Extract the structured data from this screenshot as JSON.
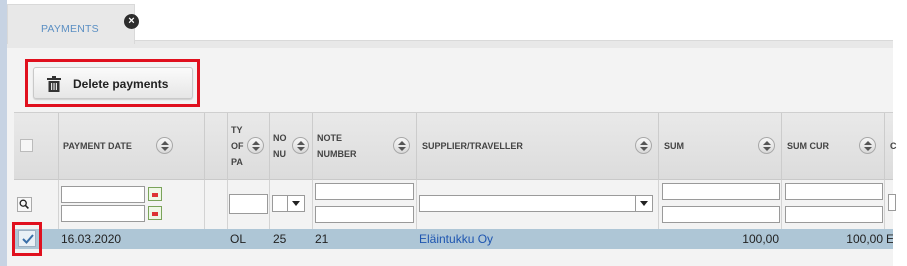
{
  "tab": {
    "label": "PAYMENTS"
  },
  "toolbar": {
    "delete_label": "Delete payments"
  },
  "columns": {
    "payment_date": "PAYMENT DATE",
    "type_line1": "TY",
    "type_line2": "OF",
    "type_line3": "PA",
    "no_line1": "NO",
    "no_line2": "NU",
    "note_line1": "NOTE",
    "note_line2": "NUMBER",
    "supplier": "SUPPLIER/TRAVELLER",
    "sum": "SUM",
    "sum_cur": "SUM CUR",
    "cut": "C"
  },
  "rows": [
    {
      "selected": true,
      "payment_date": "16.03.2020",
      "type": "OL",
      "no": "25",
      "note_number": "21",
      "supplier": "Eläintukku Oy",
      "sum": "100,00",
      "sum_cur": "100,00",
      "cut": "E"
    }
  ],
  "colors": {
    "accent": "#5b8fc3",
    "selected_row": "#aec6d6",
    "highlight": "#e0101e",
    "link": "#1e55b0"
  }
}
